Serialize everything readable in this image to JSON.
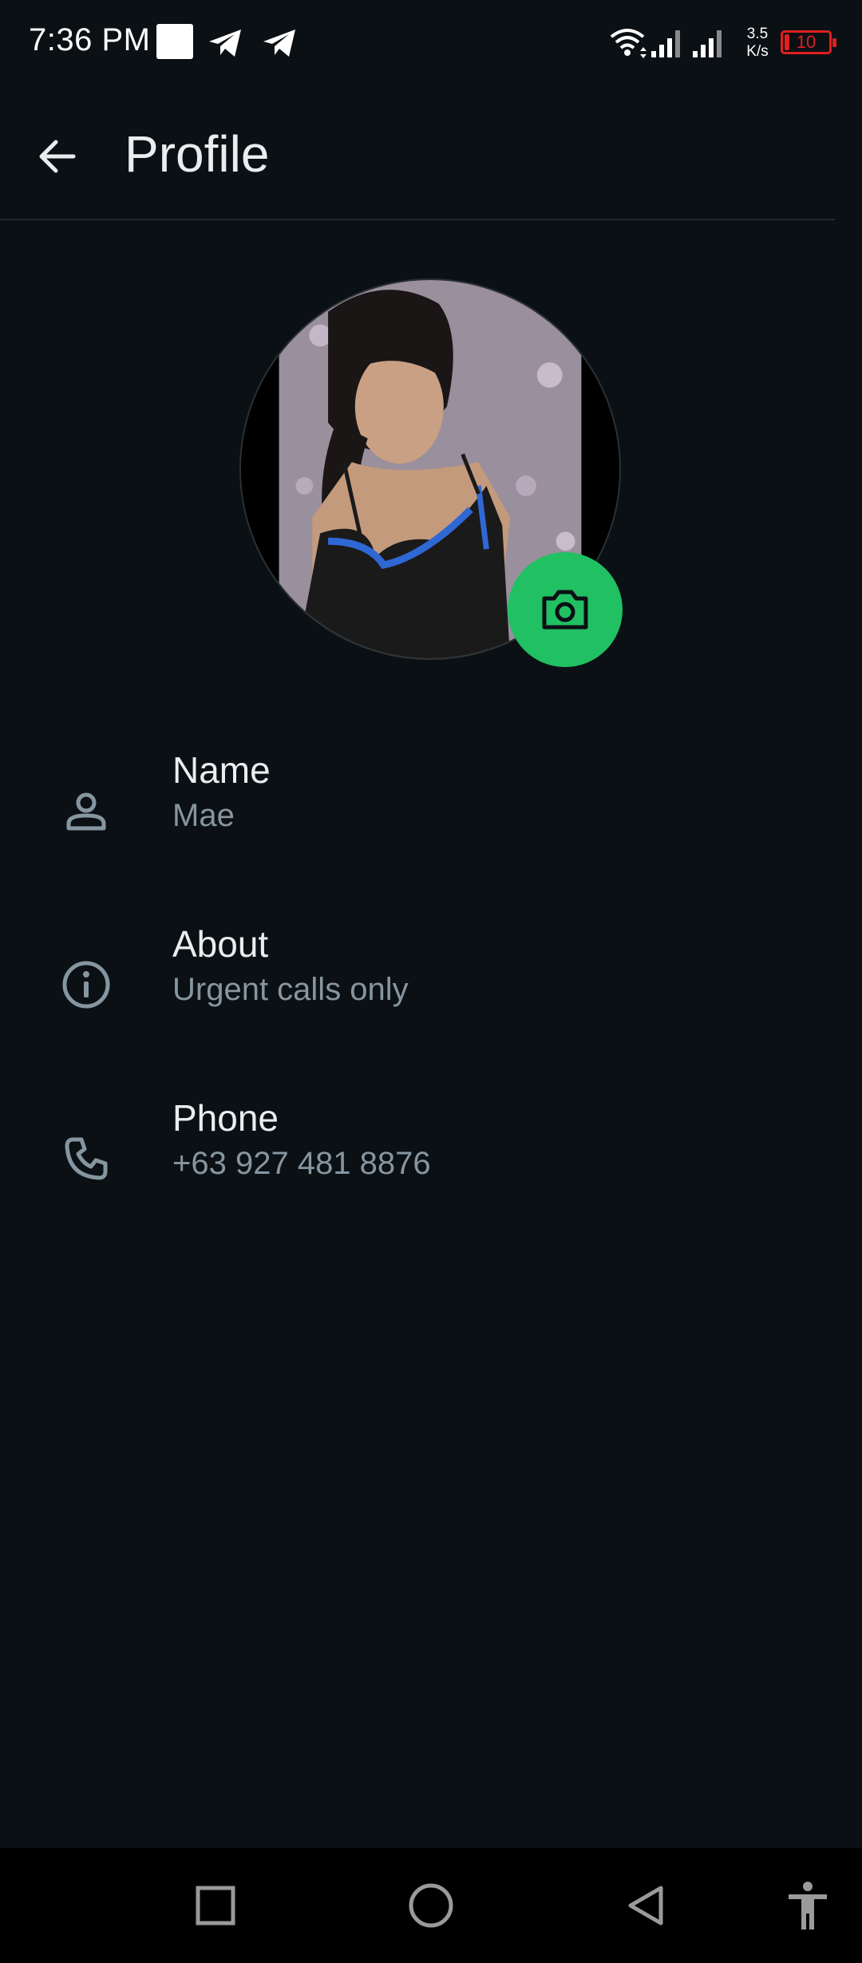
{
  "status_bar": {
    "time": "7:36 PM",
    "network_speed_value": "3.5",
    "network_speed_unit": "K/s",
    "battery_level": "10",
    "battery_color": "#e0201f"
  },
  "toolbar": {
    "back_icon": "arrow-left-icon",
    "title": "Profile"
  },
  "avatar": {
    "camera_icon": "camera-icon",
    "accent": "#21c063"
  },
  "rows": [
    {
      "icon": "person-icon",
      "label": "Name",
      "value": "Mae"
    },
    {
      "icon": "info-icon",
      "label": "About",
      "value": "Urgent calls only"
    },
    {
      "icon": "phone-icon",
      "label": "Phone",
      "value": "+63 927 481 8876"
    }
  ],
  "nav_bar": {
    "buttons": [
      "recents-square-icon",
      "home-circle-icon",
      "back-triangle-icon",
      "accessibility-icon"
    ]
  }
}
